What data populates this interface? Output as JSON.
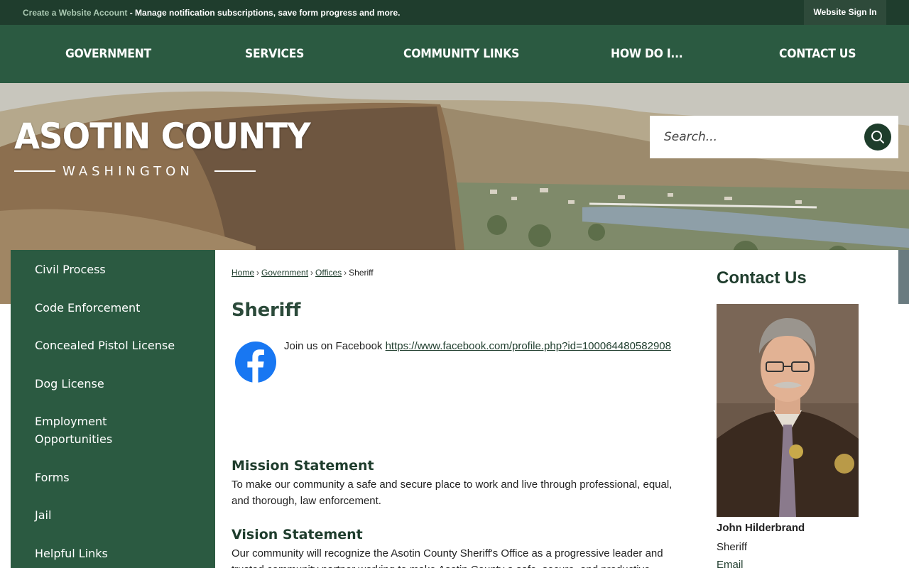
{
  "topbar": {
    "create_account_link": "Create a Website Account",
    "notice_text": " - Manage notification subscriptions, save form progress and more.",
    "signin_label": "Website Sign In"
  },
  "nav": {
    "items": [
      "GOVERNMENT",
      "SERVICES",
      "COMMUNITY LINKS",
      "HOW DO I...",
      "CONTACT US"
    ]
  },
  "logo": {
    "county": "ASOTIN COUNTY",
    "state": "WASHINGTON"
  },
  "search": {
    "placeholder": "Search..."
  },
  "sidebar": {
    "items": [
      "Civil Process",
      "Code Enforcement",
      "Concealed Pistol License",
      "Dog License",
      "Employment Opportunities",
      "Forms",
      "Jail",
      "Helpful Links"
    ]
  },
  "breadcrumb": {
    "home": "Home",
    "government": "Government",
    "offices": "Offices",
    "current": "Sheriff",
    "separator": "›"
  },
  "page": {
    "title": "Sheriff",
    "facebook_text": "Join us on Facebook ",
    "facebook_link": "https://www.facebook.com/profile.php?id=100064480582908",
    "mission_heading": "Mission Statement",
    "mission_text": "To make our community a safe and secure place to work and live through professional, equal, and thorough, law enforcement.",
    "vision_heading": "Vision Statement",
    "vision_text": "Our community will recognize the Asotin County Sheriff's Office as a progressive leader and trusted community partner working to make Asotin County a safe, secure, and productive"
  },
  "contact": {
    "title": "Contact Us",
    "name": "John Hilderbrand",
    "role": "Sheriff",
    "email_label": "Email"
  },
  "colors": {
    "dark_green": "#1f3d2d",
    "nav_green": "#2b5a41",
    "white": "#ffffff"
  },
  "icons": {
    "search": "search-icon",
    "facebook": "facebook-icon"
  }
}
